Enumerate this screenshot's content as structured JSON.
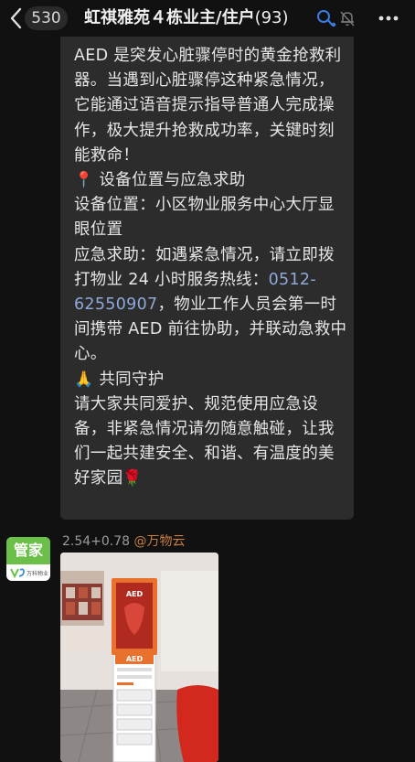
{
  "header": {
    "back_icon": "chevron-left-icon",
    "unread_count": "530",
    "group_name": "虹祺雅苑４栋业主/住户",
    "member_count": "(93)",
    "icons": [
      "voice-record-icon",
      "mute-bell-icon",
      "more-icon"
    ]
  },
  "message": {
    "lines": [
      "AED 是突发心脏骤停时的黄金抢救利器。当遇到心脏骤停这种紧急情况，它能通过语音提示指导普通人完成操作，极大提升抢救成功率，关键时刻能救命！",
      "设备位置与应急求助",
      "设备位置：小区物业服务中心大厅显眼位置",
      "应急求助：如遇紧急情况，请立即拨打物业 24 小时服务热线：",
      "0512-62550907",
      "，物业工作人员会第一时间携带 AED 前往协助，并联动急救中心。",
      "共同守护",
      "请大家共同爱护、规范使用应急设备，非紧急情况请勿随意触碰，让我们一起共建安全、和谐、有温度的美好家园"
    ],
    "emojis": {
      "pin": "📍",
      "pray": "🙏",
      "flower": "🌹"
    }
  },
  "sender": {
    "avatar_label": "管家",
    "avatar_brand": "万科物业",
    "name_prefix": "2.54+0.78",
    "mention": "@万物云"
  },
  "photo": {
    "cabinet_label": "AED",
    "stand_label": "AED"
  },
  "colors": {
    "background": "#111111",
    "bubble": "#2c2c2c",
    "link": "#8ea9d9",
    "mention": "#c77e3f",
    "avatar_green": "#6cc04a",
    "aed_orange": "#e8722d"
  }
}
